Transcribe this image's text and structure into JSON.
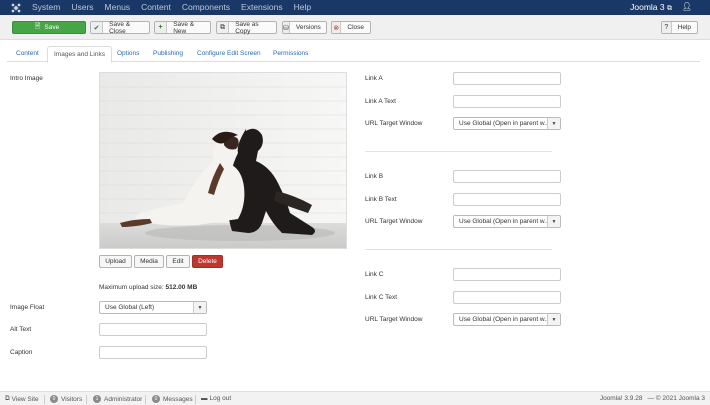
{
  "navbar": {
    "menu": [
      "System",
      "Users",
      "Menus",
      "Content",
      "Components",
      "Extensions",
      "Help"
    ],
    "brand": "Joomla 3",
    "colors": {
      "bg": "#1a3867"
    }
  },
  "toolbar": {
    "save": "Save",
    "save_close": "Save & Close",
    "save_new": "Save & New",
    "save_copy": "Save as Copy",
    "versions": "Versions",
    "close": "Close",
    "help": "Help"
  },
  "tabs": [
    "Content",
    "Images and Links",
    "Options",
    "Publishing",
    "Configure Edit Screen",
    "Permissions"
  ],
  "images": {
    "intro_label": "Intro Image",
    "buttons": {
      "upload": "Upload",
      "media": "Media",
      "edit": "Edit",
      "delete": "Delete"
    },
    "max_upload_prefix": "Maximum upload size: ",
    "max_upload_value": "512.00 MB",
    "float_label": "Image Float",
    "float_value": "Use Global (Left)",
    "alt_label": "Alt Text",
    "caption_label": "Caption"
  },
  "links": {
    "a": {
      "label": "Link A",
      "text_label": "Link A Text"
    },
    "b": {
      "label": "Link B",
      "text_label": "Link B Text"
    },
    "c": {
      "label": "Link C",
      "text_label": "Link C Text"
    },
    "target_label": "URL Target Window",
    "target_value": "Use Global (Open in parent w..."
  },
  "status": {
    "view_site": "View Site",
    "visitors_count": "0",
    "visitors": "Visitors",
    "admin_count": "1",
    "admin": "Administrator",
    "messages_count": "0",
    "messages": "Messages",
    "logout": "Log out",
    "version": "Joomla! 3.9.28",
    "copyright": "— © 2021 Joomla 3"
  }
}
